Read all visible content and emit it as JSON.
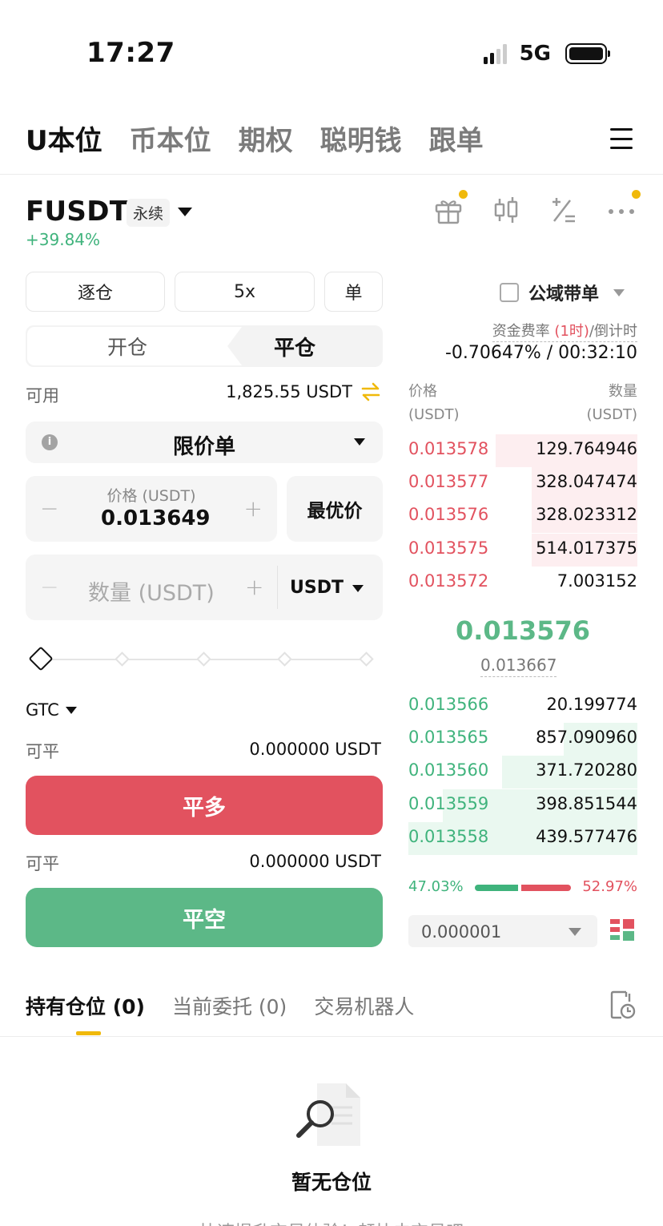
{
  "status": {
    "time": "17:27",
    "network": "5G"
  },
  "top_tabs": [
    "U本位",
    "币本位",
    "期权",
    "聪明钱",
    "跟单"
  ],
  "symbol": {
    "name": "FUSDT",
    "type_badge": "永续",
    "change": "+39.84%"
  },
  "controls": {
    "margin_mode": "逐仓",
    "leverage": "5x",
    "position_mode": "单",
    "open_tab": "开仓",
    "close_tab": "平仓"
  },
  "available": {
    "label": "可用",
    "value": "1,825.55 USDT"
  },
  "order_type": {
    "info": "i",
    "label": "限价单"
  },
  "price_input": {
    "label": "价格 (USDT)",
    "value": "0.013649",
    "minus": "−",
    "plus": "+"
  },
  "best_price_label": "最优价",
  "quantity_input": {
    "placeholder": "数量 (USDT)",
    "unit": "USDT",
    "minus": "−",
    "plus": "+"
  },
  "slider": {
    "value_fraction": 0
  },
  "time_in_force": "GTC",
  "close_long": {
    "label": "可平",
    "value": "0.000000 USDT",
    "button": "平多"
  },
  "close_short": {
    "label": "可平",
    "value": "0.000000 USDT",
    "button": "平空"
  },
  "copy_trade": {
    "label": "公域带单",
    "checked": false
  },
  "funding": {
    "label_prefix": "资金费率 ",
    "period": "(1时)",
    "label_suffix": "/倒计时",
    "value": "-0.70647% / 00:32:10"
  },
  "orderbook": {
    "price_header": "价格",
    "price_unit": "(USDT)",
    "qty_header": "数量",
    "qty_unit": "(USDT)",
    "asks": [
      {
        "price": "0.013578",
        "qty": "129.764946",
        "depth": 0.62
      },
      {
        "price": "0.013577",
        "qty": "328.047474",
        "depth": 0.46
      },
      {
        "price": "0.013576",
        "qty": "328.023312",
        "depth": 0.46
      },
      {
        "price": "0.013575",
        "qty": "514.017375",
        "depth": 0.46
      },
      {
        "price": "0.013572",
        "qty": "7.003152",
        "depth": 0.0
      }
    ],
    "mid_price": "0.013576",
    "mark_price": "0.013667",
    "bids": [
      {
        "price": "0.013566",
        "qty": "20.199774",
        "depth": 0.0
      },
      {
        "price": "0.013565",
        "qty": "857.090960",
        "depth": 0.32
      },
      {
        "price": "0.013560",
        "qty": "371.720280",
        "depth": 0.59
      },
      {
        "price": "0.013559",
        "qty": "398.851544",
        "depth": 0.85
      },
      {
        "price": "0.013558",
        "qty": "439.577476",
        "depth": 1.0
      }
    ],
    "buy_ratio": "47.03%",
    "sell_ratio": "52.97%",
    "buy_fraction": 0.4703,
    "precision": "0.000001"
  },
  "bottom_tabs": [
    "持有仓位 (0)",
    "当前委托 (0)",
    "交易机器人"
  ],
  "empty_state": {
    "title": "暂无仓位",
    "subtitle": "快速提升交易体验！赶快去交易吧"
  },
  "colors": {
    "red": "#e2525f",
    "green": "#5cb887",
    "accent": "#f0b90b"
  }
}
